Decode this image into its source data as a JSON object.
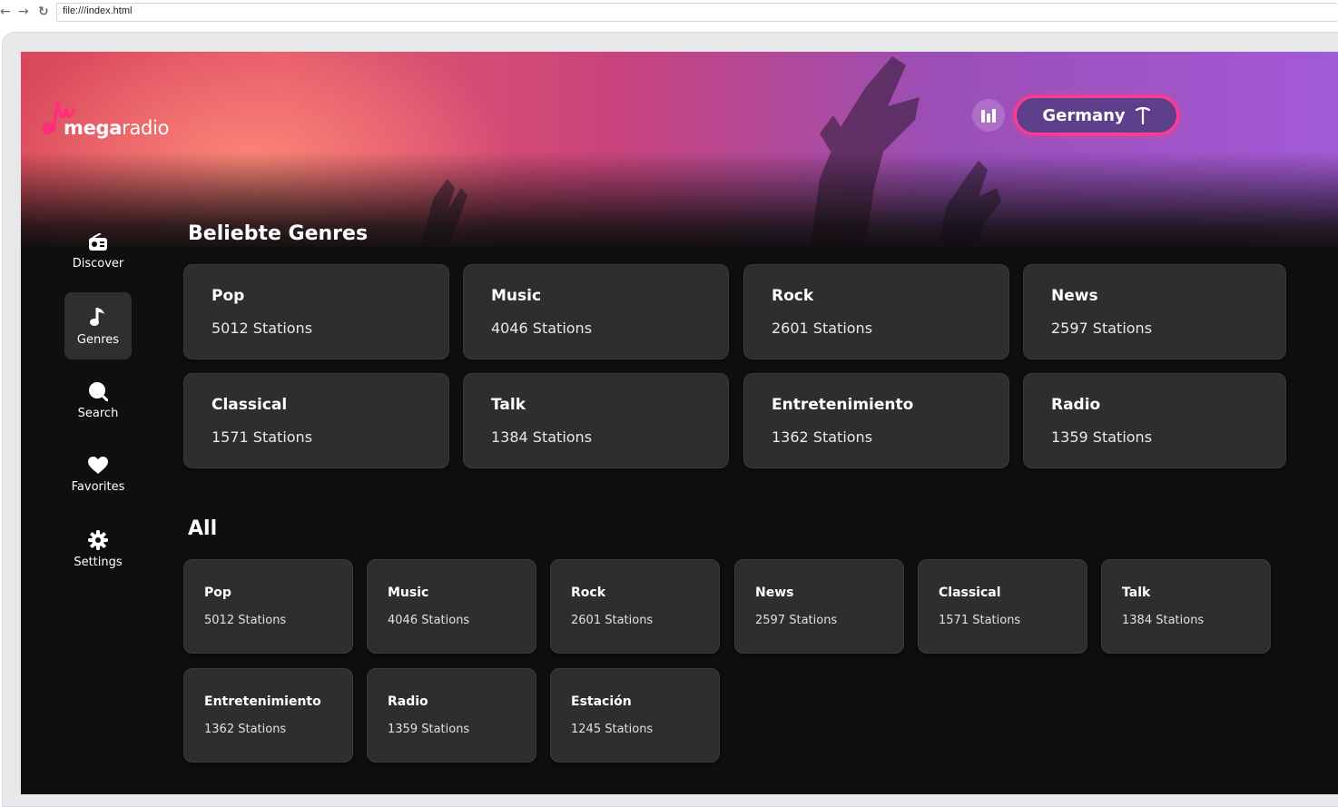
{
  "browser": {
    "url": "file:///index.html"
  },
  "brand": {
    "logo_word_bold": "mega",
    "logo_word_rest": "radio"
  },
  "header": {
    "country_label": "Germany"
  },
  "sidebar": {
    "items": [
      {
        "label": "Discover",
        "icon": "radio-icon"
      },
      {
        "label": "Genres",
        "icon": "music-note-icon",
        "active": true
      },
      {
        "label": "Search",
        "icon": "search-icon"
      },
      {
        "label": "Favorites",
        "icon": "heart-icon"
      },
      {
        "label": "Settings",
        "icon": "gear-icon"
      }
    ]
  },
  "popular": {
    "title": "Beliebte Genres",
    "cards": [
      {
        "name": "Pop",
        "count": "5012 Stations"
      },
      {
        "name": "Music",
        "count": "4046 Stations"
      },
      {
        "name": "Rock",
        "count": "2601 Stations"
      },
      {
        "name": "News",
        "count": "2597 Stations"
      },
      {
        "name": "Classical",
        "count": "1571 Stations"
      },
      {
        "name": "Talk",
        "count": "1384 Stations"
      },
      {
        "name": "Entretenimiento",
        "count": "1362 Stations"
      },
      {
        "name": "Radio",
        "count": "1359 Stations"
      }
    ]
  },
  "all": {
    "title": "All",
    "cards": [
      {
        "name": "Pop",
        "count": "5012 Stations"
      },
      {
        "name": "Music",
        "count": "4046 Stations"
      },
      {
        "name": "Rock",
        "count": "2601 Stations"
      },
      {
        "name": "News",
        "count": "2597 Stations"
      },
      {
        "name": "Classical",
        "count": "1571 Stations"
      },
      {
        "name": "Talk",
        "count": "1384 Stations"
      },
      {
        "name": "Entretenimiento",
        "count": "1362 Stations"
      },
      {
        "name": "Radio",
        "count": "1359 Stations"
      },
      {
        "name": "Estación",
        "count": "1245 Stations"
      }
    ]
  },
  "colors": {
    "accent": "#ff3b8d",
    "country_button": "#5e3f8c",
    "card": "#2e2e2e",
    "background": "#0f0f0f"
  }
}
